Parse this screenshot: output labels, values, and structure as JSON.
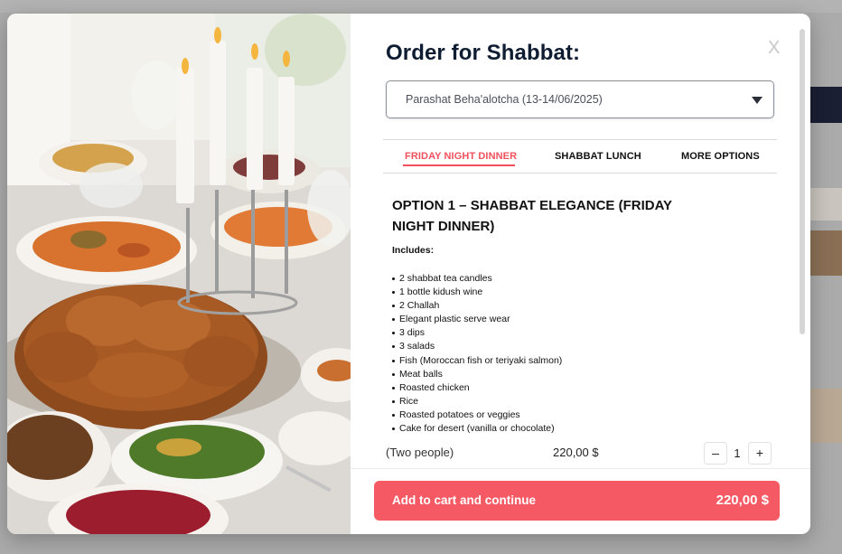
{
  "modal": {
    "title": "Order for Shabbat:",
    "close_label": "X",
    "photo_alt": "Shabbat dinner table with challah and candles"
  },
  "parasha_select": {
    "value": "Parashat Beha'alotcha (13-14/06/2025)"
  },
  "tabs": [
    {
      "label": "FRIDAY NIGHT DINNER",
      "active": true
    },
    {
      "label": "SHABBAT LUNCH",
      "active": false
    },
    {
      "label": "MORE OPTIONS",
      "active": false
    }
  ],
  "option": {
    "title": "OPTION 1 – SHABBAT ELEGANCE (FRIDAY NIGHT DINNER)",
    "includes_label": "Includes:",
    "items": [
      "2 shabbat tea candles",
      "1 bottle kidush wine",
      "2 Challah",
      "Elegant plastic serve wear",
      "3 dips",
      "3 salads",
      "Fish (Moroccan fish or teriyaki salmon)",
      "Meat balls",
      "Roasted chicken",
      "Rice",
      "Roasted potatoes or veggies",
      "Cake for desert (vanilla or chocolate)"
    ],
    "people_label": "(Two people)",
    "price": "220,00 $",
    "quantity": "1",
    "minus_label": "–",
    "plus_label": "+"
  },
  "cart_button": {
    "label": "Add to cart and continue",
    "total": "220,00 $"
  },
  "colors": {
    "accent": "#f55a64",
    "title": "#0f1d33"
  }
}
